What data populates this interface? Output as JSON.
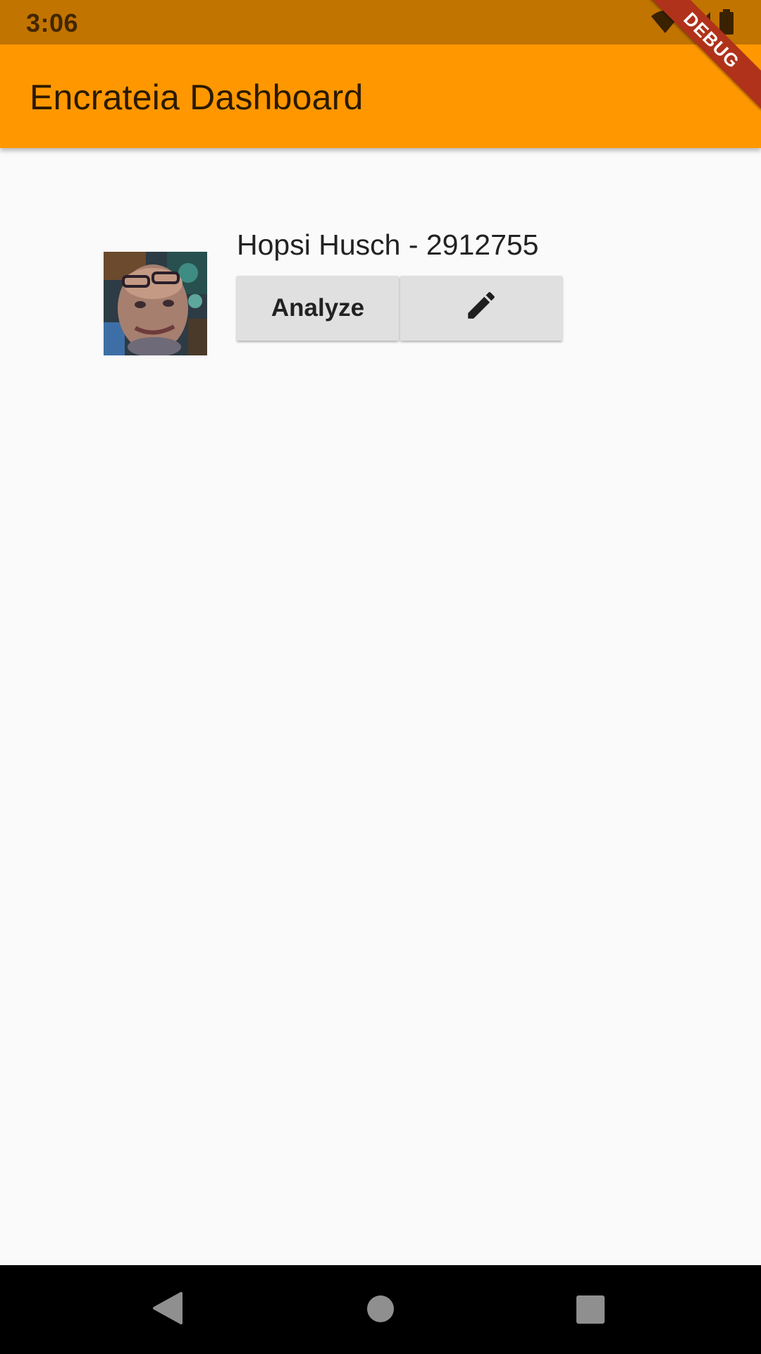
{
  "status_bar": {
    "time": "3:06"
  },
  "app_bar": {
    "title": "Encrateia Dashboard"
  },
  "debug_banner": {
    "label": "DEBUG"
  },
  "athlete": {
    "name_line": "Hopsi Husch - 2912755"
  },
  "actions": {
    "analyze_label": "Analyze",
    "edit_icon": "pencil-icon"
  },
  "colors": {
    "status_bar": "#c27401",
    "app_bar": "#ff9800",
    "background": "#fafafa",
    "button": "#e0e0e0",
    "debug_banner": "#b0321a",
    "nav_bar": "#000000"
  },
  "icons": {
    "status": [
      "wifi-icon",
      "cell-signal-icon",
      "battery-icon"
    ],
    "nav": [
      "back-icon",
      "home-icon",
      "recents-icon"
    ]
  }
}
